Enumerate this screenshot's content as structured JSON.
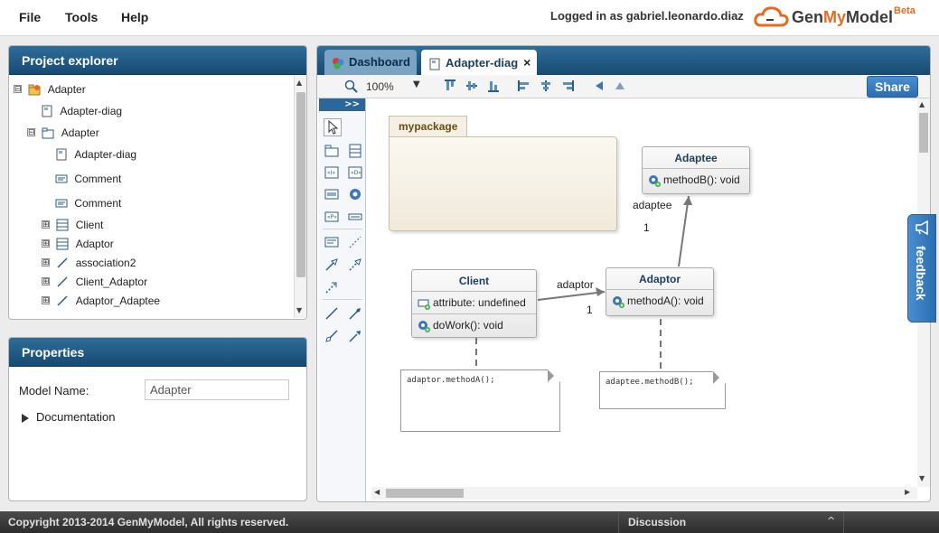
{
  "menu": {
    "file": "File",
    "tools": "Tools",
    "help": "Help"
  },
  "user": {
    "logged_in_text": "Logged in as gabriel.leonardo.diaz"
  },
  "logo": {
    "name_part1": "Gen",
    "name_part2": "My",
    "name_part3": "Model",
    "beta": "Beta"
  },
  "explorer": {
    "title": "Project explorer",
    "items": [
      {
        "label": "Adapter",
        "icon": "project-icon",
        "toggle": "⊟"
      },
      {
        "label": "Adapter-diag",
        "icon": "diagram-icon",
        "toggle": ""
      },
      {
        "label": "Adapter",
        "icon": "package-icon",
        "toggle": "⊟"
      },
      {
        "label": "Adapter-diag",
        "icon": "diagram-icon",
        "toggle": ""
      },
      {
        "label": "Comment",
        "icon": "comment-icon",
        "toggle": ""
      },
      {
        "label": "Comment",
        "icon": "comment-icon",
        "toggle": ""
      },
      {
        "label": "Client",
        "icon": "class-icon",
        "toggle": "⊞"
      },
      {
        "label": "Adaptor",
        "icon": "class-icon",
        "toggle": "⊞"
      },
      {
        "label": "association2",
        "icon": "association-icon",
        "toggle": "⊞"
      },
      {
        "label": "Client_Adaptor",
        "icon": "association-icon",
        "toggle": "⊞"
      },
      {
        "label": "Adaptor_Adaptee",
        "icon": "association-icon",
        "toggle": "⊞"
      }
    ]
  },
  "properties": {
    "title": "Properties",
    "model_name_label": "Model Name:",
    "model_name_value": "Adapter",
    "documentation_label": "Documentation"
  },
  "editor": {
    "tabs": {
      "dashboard": "Dashboard",
      "diagram": "Adapter-diag",
      "close_glyph": "×"
    },
    "zoom": "100%",
    "share": "Share",
    "palette_toggle": ">>"
  },
  "diagram": {
    "package": {
      "name": "mypackage"
    },
    "classes": {
      "client": {
        "name": "Client",
        "attribute": "attribute: undefined",
        "operation": "doWork(): void"
      },
      "adaptor": {
        "name": "Adaptor",
        "operation": "methodA(): void"
      },
      "adaptee": {
        "name": "Adaptee",
        "operation": "methodB(): void"
      }
    },
    "associations": {
      "client_adaptor": {
        "role": "adaptor",
        "multiplicity": "1"
      },
      "adaptor_adaptee": {
        "role": "adaptee",
        "multiplicity": "1"
      }
    },
    "notes": {
      "client_note": "adaptor.methodA();",
      "adaptor_note": "adaptee.methodB();"
    }
  },
  "feedback": {
    "label": "feedback"
  },
  "footer": {
    "copyright": "Copyright 2013-2014 GenMyModel, All rights reserved.",
    "discussion": "Discussion"
  },
  "colors": {
    "header_blue": "#164a72",
    "share_blue": "#2a6db2",
    "brand_orange": "#e66b1f"
  }
}
